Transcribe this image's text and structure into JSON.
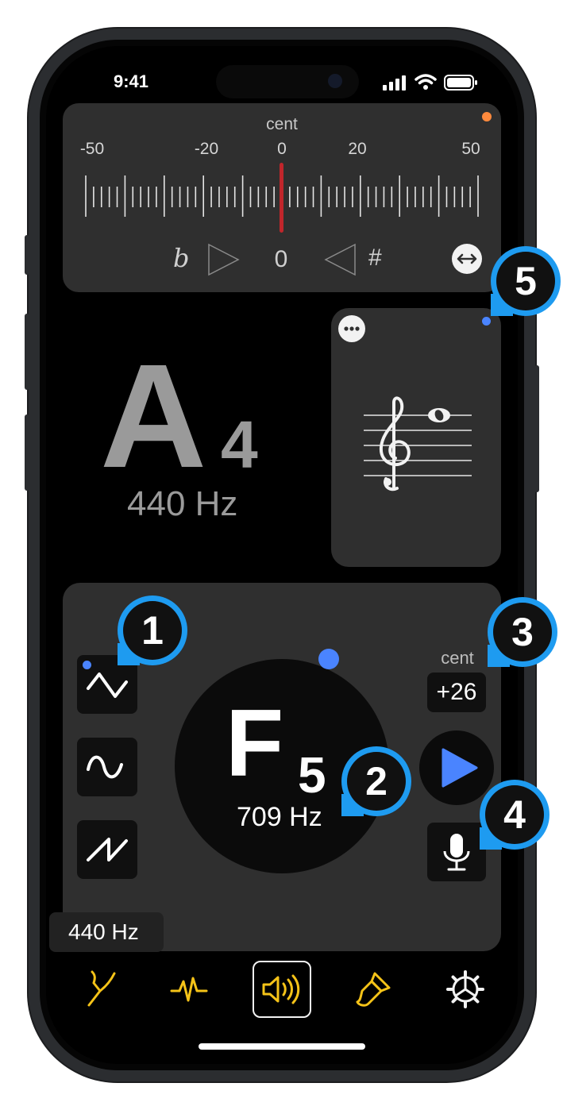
{
  "status_bar": {
    "time": "9:41"
  },
  "cent_meter": {
    "label": "cent",
    "scale": [
      "-50",
      "-20",
      "0",
      "20",
      "50"
    ],
    "flat_symbol": "b",
    "sharp_symbol": "#",
    "center_value": "0",
    "indicator_color": "#ff8a3d",
    "needle_color": "#c0262b"
  },
  "reference_note": {
    "letter": "A",
    "octave": "4",
    "frequency": "440 Hz"
  },
  "staff_card": {
    "indicator_color": "#4a84ff"
  },
  "generator": {
    "waveforms": [
      "triangle-wave",
      "sine-wave",
      "sawtooth-wave"
    ],
    "note_letter": "F",
    "note_octave": "5",
    "frequency": "709 Hz",
    "cent_label": "cent",
    "cent_value": "+26",
    "reference": "440 Hz",
    "accent_color": "#4a84ff"
  },
  "callouts": [
    "1",
    "2",
    "3",
    "4",
    "5"
  ],
  "tab_bar": {
    "items": [
      "tuning-fork-icon",
      "waveform-pulse-icon",
      "speaker-sound-icon",
      "paint-brush-icon",
      "settings-gear-icon"
    ],
    "active_index": 2,
    "accent_color": "#f5c318"
  }
}
